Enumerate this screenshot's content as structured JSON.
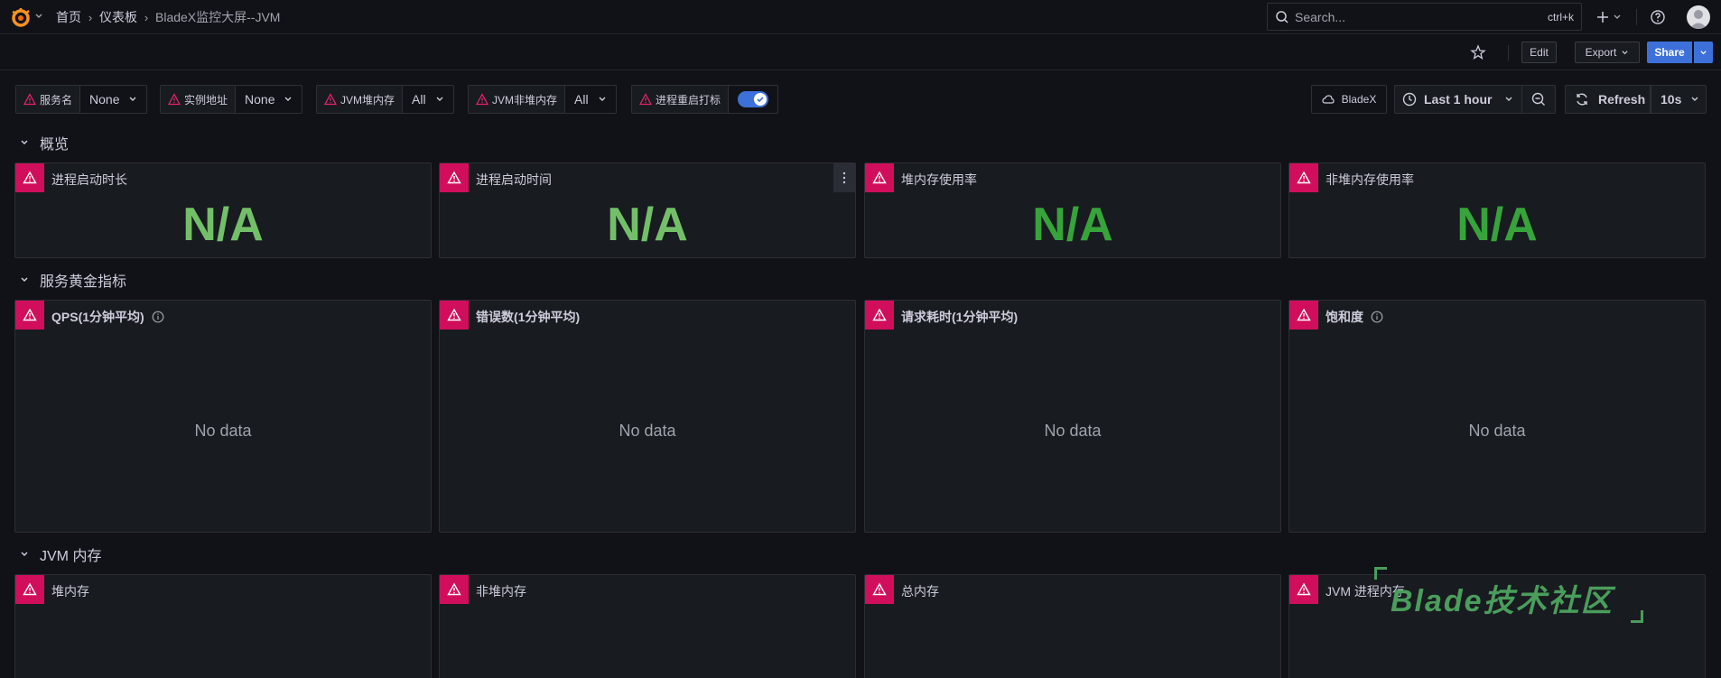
{
  "breadcrumb": [
    "首页",
    "仪表板",
    "BladeX监控大屏--JVM"
  ],
  "search": {
    "placeholder": "Search...",
    "shortcut": "ctrl+k"
  },
  "toolbar": {
    "edit_label": "Edit",
    "export_label": "Export",
    "share_label": "Share"
  },
  "variables": [
    {
      "label": "服务名",
      "value": "None"
    },
    {
      "label": "实例地址",
      "value": "None"
    },
    {
      "label": "JVM堆内存",
      "value": "All"
    },
    {
      "label": "JVM非堆内存",
      "value": "All"
    },
    {
      "label": "进程重启打标",
      "toggle": true
    }
  ],
  "controls": {
    "datasource": "BladeX",
    "time_range": "Last 1 hour",
    "refresh_label": "Refresh",
    "refresh_interval": "10s"
  },
  "rows": [
    {
      "title": "概览",
      "panels": [
        {
          "title": "进程启动时长",
          "value": "N/A"
        },
        {
          "title": "进程启动时间",
          "value": "N/A"
        },
        {
          "title": "堆内存使用率",
          "value": "N/A"
        },
        {
          "title": "非堆内存使用率",
          "value": "N/A"
        }
      ]
    },
    {
      "title": "服务黄金指标",
      "panels": [
        {
          "title": "QPS(1分钟平均)",
          "message": "No data"
        },
        {
          "title": "错误数(1分钟平均)",
          "message": "No data"
        },
        {
          "title": "请求耗时(1分钟平均)",
          "message": "No data"
        },
        {
          "title": "饱和度",
          "message": "No data"
        }
      ]
    },
    {
      "title": "JVM 内存",
      "panels": [
        {
          "title": "堆内存"
        },
        {
          "title": "非堆内存"
        },
        {
          "title": "总内存"
        },
        {
          "title": "JVM 进程内存"
        }
      ]
    }
  ],
  "watermark": "Blade技术社区",
  "colors": {
    "stat_green_1": "#73bf69",
    "stat_green_2": "#37a33b",
    "accent_blue": "#3d71d9",
    "error_red": "#d10e5c"
  },
  "icons": {
    "logo": "grafana-logo-icon",
    "search": "search-icon",
    "star": "star-icon",
    "warning": "warning-icon",
    "clock": "clock-icon",
    "refresh": "refresh-icon",
    "cloud": "cloud-icon",
    "zoom_out": "zoom-out-icon",
    "help": "help-icon",
    "info": "info-icon"
  }
}
